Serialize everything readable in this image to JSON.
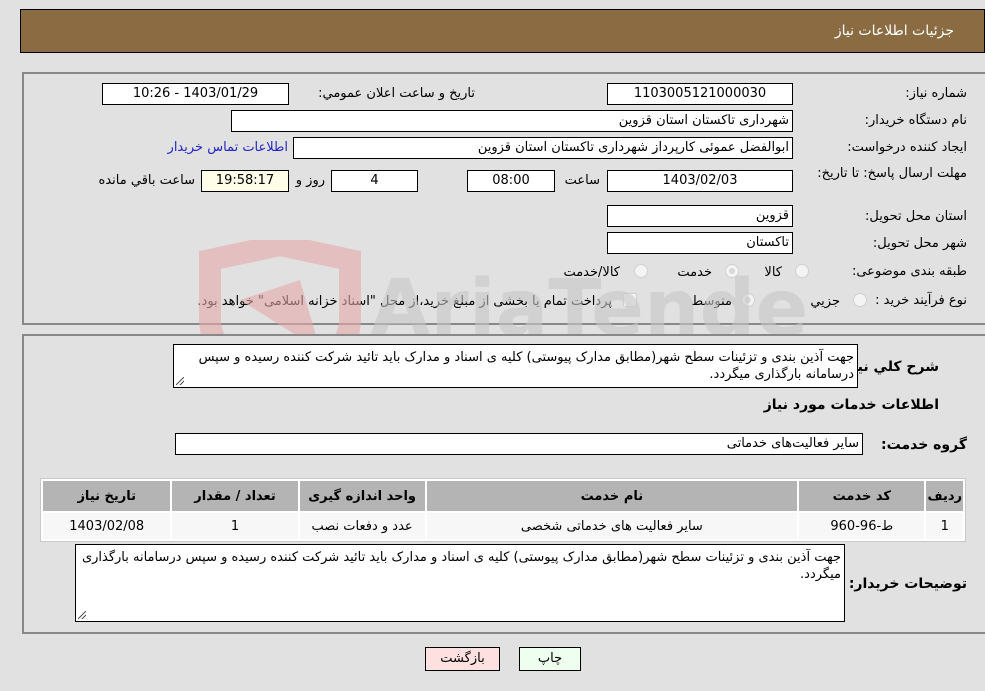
{
  "header": {
    "title": "جزئیات اطلاعات نیاز"
  },
  "form": {
    "need_number": {
      "label": "شماره نیاز:",
      "value": "1103005121000030"
    },
    "announce_datetime": {
      "label": "تاریخ و ساعت اعلان عمومي:",
      "value": "1403/01/29 - 10:26"
    },
    "buyer_org": {
      "label": "نام دستگاه خريدار:",
      "value": "شهرداری تاکستان استان قزوین"
    },
    "requester": {
      "label": "ایجاد کننده درخواست:",
      "value": "ابوالفضل عموئی کارپرداز شهرداری تاکستان استان قزوین"
    },
    "buyer_contact_link": "اطلاعات تماس خريدار",
    "deadline": {
      "label": "مهلت ارسال پاسخ: تا تاریخ:",
      "date": "1403/02/03",
      "time_label": "ساعت",
      "time": "08:00",
      "days": "4",
      "days_label": "روز و",
      "remaining_time": "19:58:17",
      "remaining_label": "ساعت باقي مانده"
    },
    "delivery_province": {
      "label": "استان محل تحويل:",
      "value": "قزوین"
    },
    "delivery_city": {
      "label": "شهر محل تحويل:",
      "value": "تاکستان"
    },
    "category": {
      "label": "طبقه بندی موضوعی:",
      "options": [
        "کالا",
        "خدمت",
        "کالا/خدمت"
      ],
      "selected": "خدمت"
    },
    "purchase_type": {
      "label": "نوع فرآيند خريد :",
      "options": [
        "جزيي",
        "متوسط"
      ],
      "selected": "متوسط",
      "treasury_note": "پرداخت تمام يا بخشی از مبلغ خريد،از محل \"اسناد خزانه اسلامی\" خواهد بود."
    }
  },
  "description": {
    "label": "شرح كلي نياز:",
    "value": "جهت آذین بندی و تزئینات سطح شهر(مطابق مدارک پیوستی) کلیه ی اسناد و مدارک باید تائید شرکت کننده رسیده و سپس درسامانه بارگذاری میگردد."
  },
  "services": {
    "section_title": "اطلاعات خدمات مورد نياز",
    "group_label": "گروه خدمت:",
    "group_value": "ساير فعاليت‌هاى خدماتى",
    "table": {
      "headers": [
        "رديف",
        "کد خدمت",
        "نام خدمت",
        "واحد اندازه گیری",
        "تعداد / مقدار",
        "تاریخ نیاز"
      ],
      "rows": [
        [
          "1",
          "ط-96-960",
          "سایر فعالیت های خدماتی شخصی",
          "عدد و دفعات نصب",
          "1",
          "1403/02/08"
        ]
      ]
    }
  },
  "buyer_notes": {
    "label": "توضيحات خريدار:",
    "value": "جهت آذین بندی و تزئینات سطح شهر(مطابق مدارک پیوستی) کلیه ی اسناد و مدارک باید تائید شرکت کننده رسیده و سپس درسامانه بارگذاری میگردد."
  },
  "buttons": {
    "print": "چاپ",
    "back": "بازگشت"
  },
  "watermark": {
    "text": "AriaTender.neT"
  }
}
